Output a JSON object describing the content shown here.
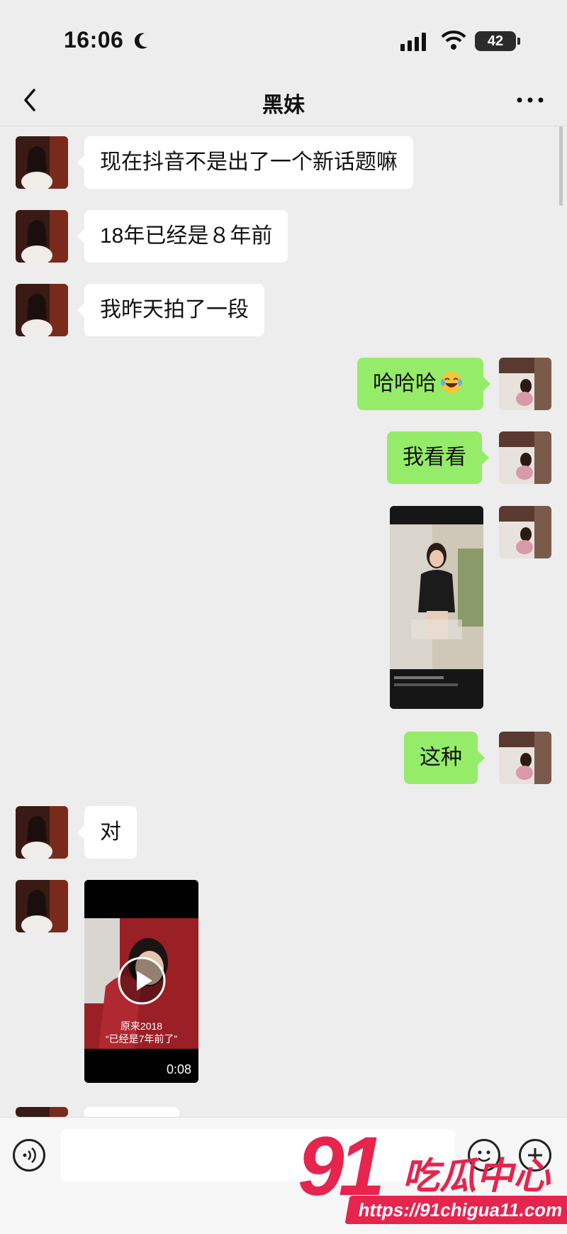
{
  "status_bar": {
    "time": "16:06",
    "battery": "42"
  },
  "header": {
    "title": "黑妹"
  },
  "messages": [
    {
      "side": "in",
      "text": "现在抖音不是出了一个新话题嘛"
    },
    {
      "side": "in",
      "text": "18年已经是８年前"
    },
    {
      "side": "in",
      "text": "我昨天拍了一段"
    },
    {
      "side": "out",
      "text": "哈哈哈"
    },
    {
      "side": "out",
      "text": "我看看"
    },
    {
      "side": "out",
      "type": "image"
    },
    {
      "side": "out",
      "text": "这种"
    },
    {
      "side": "in",
      "text": "对"
    },
    {
      "side": "in",
      "type": "video",
      "caption1": "原来2018",
      "caption2": "“已经是7年前了”",
      "duration": "0:08"
    }
  ],
  "input": {
    "placeholder": ""
  },
  "watermark": {
    "logo": "91",
    "cn": "吃瓜中心",
    "url": "https://91chigua11.com"
  },
  "colors": {
    "background": "#ededed",
    "bubble_in": "#ffffff",
    "bubble_out": "#95ec69",
    "watermark": "#e6244e"
  },
  "icons": [
    "moon-icon",
    "signal-icon",
    "wifi-icon",
    "back-icon",
    "more-icon",
    "voice-icon",
    "emoji-icon",
    "plus-icon",
    "play-icon"
  ]
}
